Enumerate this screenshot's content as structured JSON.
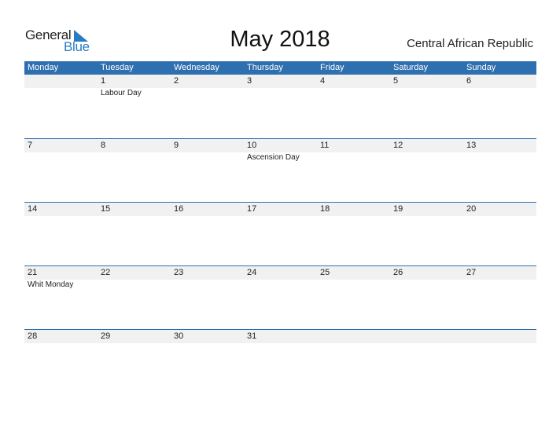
{
  "logo": {
    "line1": "General",
    "line2": "Blue"
  },
  "title": "May 2018",
  "country": "Central African Republic",
  "weekdays": [
    "Monday",
    "Tuesday",
    "Wednesday",
    "Thursday",
    "Friday",
    "Saturday",
    "Sunday"
  ],
  "weeks": [
    {
      "days": [
        "",
        "1",
        "2",
        "3",
        "4",
        "5",
        "6"
      ],
      "events": [
        "",
        "Labour Day",
        "",
        "",
        "",
        "",
        ""
      ]
    },
    {
      "days": [
        "7",
        "8",
        "9",
        "10",
        "11",
        "12",
        "13"
      ],
      "events": [
        "",
        "",
        "",
        "Ascension Day",
        "",
        "",
        ""
      ]
    },
    {
      "days": [
        "14",
        "15",
        "16",
        "17",
        "18",
        "19",
        "20"
      ],
      "events": [
        "",
        "",
        "",
        "",
        "",
        "",
        ""
      ]
    },
    {
      "days": [
        "21",
        "22",
        "23",
        "24",
        "25",
        "26",
        "27"
      ],
      "events": [
        "Whit Monday",
        "",
        "",
        "",
        "",
        "",
        ""
      ]
    },
    {
      "days": [
        "28",
        "29",
        "30",
        "31",
        "",
        "",
        ""
      ],
      "events": [
        "",
        "",
        "",
        "",
        "",
        "",
        ""
      ]
    }
  ],
  "colors": {
    "accent": "#2e6fb0",
    "logo_blue": "#2a7bc4",
    "day_row_bg": "#f1f1f1"
  }
}
